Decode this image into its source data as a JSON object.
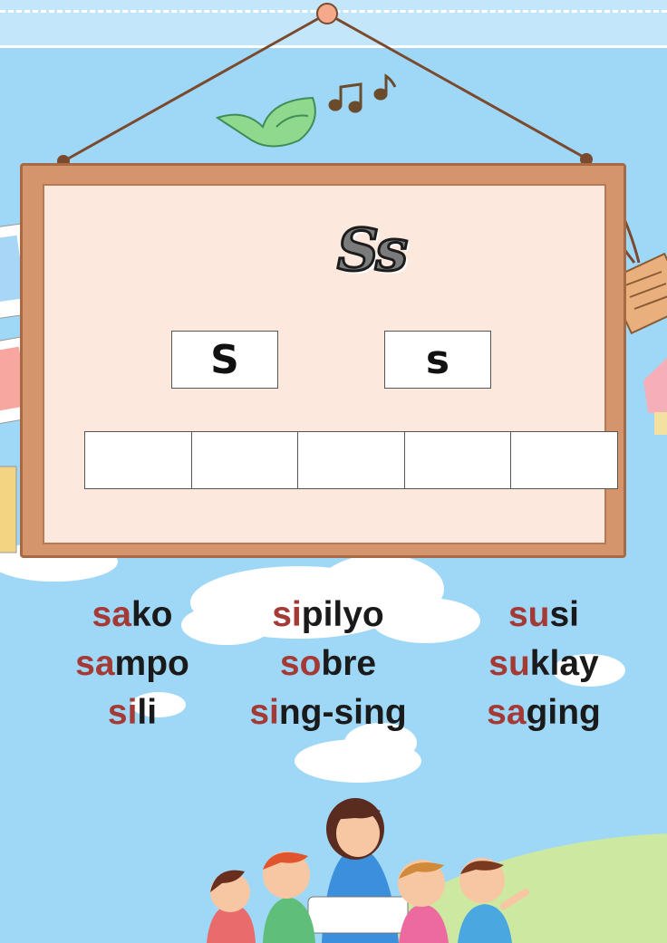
{
  "board": {
    "title": "Ss",
    "upper": "S",
    "lower": "s",
    "blank_cells": 5
  },
  "words": [
    [
      {
        "syl": "sa",
        "rest": "ko"
      },
      {
        "syl": "sa",
        "rest": "mpo"
      },
      {
        "syl": "si",
        "rest": "li"
      }
    ],
    [
      {
        "syl": "si",
        "rest": "pilyo"
      },
      {
        "syl": "so",
        "rest": "bre"
      },
      {
        "syl": "si",
        "rest": "ng-sing"
      }
    ],
    [
      {
        "syl": "su",
        "rest": "si"
      },
      {
        "syl": "su",
        "rest": "klay"
      },
      {
        "syl": "sa",
        "rest": "ging"
      }
    ]
  ],
  "colors": {
    "sky": "#9fd8f7",
    "highlight": "#a43a36",
    "board": "#d4956c",
    "board_inner": "#fde8dd"
  },
  "icons": [
    "bird-icon",
    "music-notes-icon",
    "photo-frames-icon",
    "tag-icon",
    "cloud-icon",
    "teacher-and-children-illustration"
  ]
}
